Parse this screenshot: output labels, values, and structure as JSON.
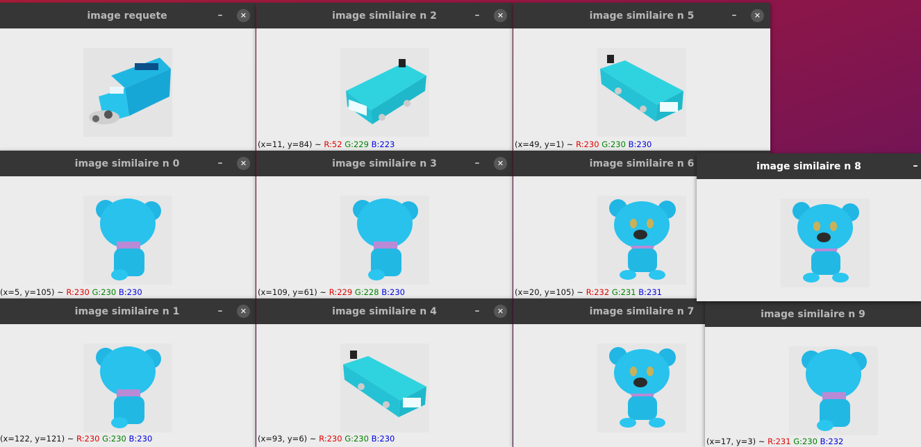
{
  "windows": [
    {
      "id": "requete",
      "title": "image requete",
      "subject": "truck-icon",
      "status": null
    },
    {
      "id": "n2",
      "title": "image similaire n 2",
      "subject": "bus-icon",
      "status": {
        "coords": "(x=11, y=84) ~ ",
        "r": "R:52",
        "g": "G:229",
        "b": "B:223"
      }
    },
    {
      "id": "n5",
      "title": "image similaire n 5",
      "subject": "bus-icon",
      "status": {
        "coords": "(x=49, y=1) ~ ",
        "r": "R:230",
        "g": "G:230",
        "b": "B:230"
      }
    },
    {
      "id": "n0",
      "title": "image similaire n 0",
      "subject": "bear-back-icon",
      "status": {
        "coords": "(x=5, y=105) ~ ",
        "r": "R:230",
        "g": "G:230",
        "b": "B:230"
      }
    },
    {
      "id": "n3",
      "title": "image similaire n 3",
      "subject": "bear-back-icon",
      "status": {
        "coords": "(x=109, y=61) ~ ",
        "r": "R:229",
        "g": "G:228",
        "b": "B:230"
      }
    },
    {
      "id": "n6",
      "title": "image similaire n 6",
      "subject": "bear-front-icon",
      "status": {
        "coords": "(x=20, y=105) ~ ",
        "r": "R:232",
        "g": "G:231",
        "b": "B:231"
      }
    },
    {
      "id": "n8",
      "title": "image similaire n 8",
      "subject": "bear-front-icon",
      "status": null
    },
    {
      "id": "n1",
      "title": "image similaire n 1",
      "subject": "bear-back-icon",
      "status": {
        "coords": "(x=122, y=121) ~ ",
        "r": "R:230",
        "g": "G:230",
        "b": "B:230"
      }
    },
    {
      "id": "n4",
      "title": "image similaire n 4",
      "subject": "bus-icon",
      "status": {
        "coords": "(x=93, y=6) ~ ",
        "r": "R:230",
        "g": "G:230",
        "b": "B:230"
      }
    },
    {
      "id": "n7",
      "title": "image similaire n 7",
      "subject": "bear-front-icon",
      "status": null
    },
    {
      "id": "n9",
      "title": "image similaire n 9",
      "subject": "bear-back-icon",
      "status": {
        "coords": "(x=17, y=3) ~ ",
        "r": "R:231",
        "g": "G:230",
        "b": "B:232"
      }
    }
  ],
  "controls": {
    "minimize_glyph": "–",
    "close_glyph": "✕"
  },
  "colors": {
    "titlebar": "#363636",
    "toy_cyan": "#29c3e8",
    "scarf": "#b98ad6",
    "desktop": "#8e1648"
  }
}
